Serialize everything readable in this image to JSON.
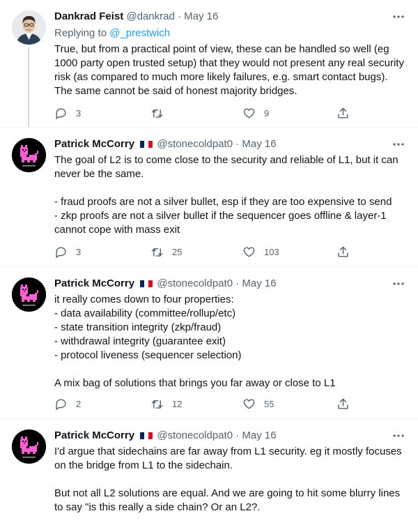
{
  "tweets": [
    {
      "name": "Dankrad Feist",
      "handle": "@dankrad",
      "dot": "·",
      "date": "May 16",
      "reply_prefix": "Replying to ",
      "reply_mention": "@_prestwich",
      "lines": [
        "True, but from a practical point of view, these can be handled so well (eg",
        "1000 party open trusted setup) that they would not present any real security",
        "risk (as compared to much more likely failures, e.g. smart contact bugs).",
        "The same cannot be said of honest majority bridges."
      ],
      "replies": "3",
      "retweets": "",
      "likes": "9"
    },
    {
      "name": "Patrick McCorry",
      "handle": "@stonecoldpat0",
      "dot": "·",
      "date": "May 16",
      "lines": [
        "The goal of L2 is to come close to the security and reliable of L1, but it can",
        "never be the same.",
        "",
        "- fraud proofs are not a silver bullet, esp if they are too expensive to send",
        "- zkp proofs are not a silver bullet if the sequencer goes offline & layer-1",
        "cannot cope with mass exit"
      ],
      "replies": "3",
      "retweets": "25",
      "likes": "103"
    },
    {
      "name": "Patrick McCorry",
      "handle": "@stonecoldpat0",
      "dot": "·",
      "date": "May 16",
      "lines": [
        "it really comes down to four properties:",
        "- data availability (committee/rollup/etc)",
        "- state transition integrity (zkp/fraud)",
        "- withdrawal integrity (guarantee exit)",
        "- protocol liveness (sequencer selection)",
        "",
        "A mix bag of solutions that brings you far away or close to L1"
      ],
      "replies": "2",
      "retweets": "12",
      "likes": "55"
    },
    {
      "name": "Patrick McCorry",
      "handle": "@stonecoldpat0",
      "dot": "·",
      "date": "May 16",
      "lines": [
        "I'd argue that sidechains are far away from L1 security. eg it mostly focuses",
        "on the bridge from L1 to the sidechain.",
        "",
        "But not all L2 solutions are equal. And we are going to hit some blurry lines",
        "to say \"is this really a side chain? Or an L2?."
      ]
    }
  ],
  "colors": {
    "text": "#0f1419",
    "secondary": "#536471",
    "link": "#1d9bf0",
    "thread_line": "#cfd9de",
    "cat_pink": "#ff5fd2",
    "flag": [
      "#002654",
      "#ffffff",
      "#ce1126"
    ]
  },
  "icons": [
    "more-icon",
    "reply-icon",
    "retweet-icon",
    "like-icon",
    "share-icon"
  ]
}
